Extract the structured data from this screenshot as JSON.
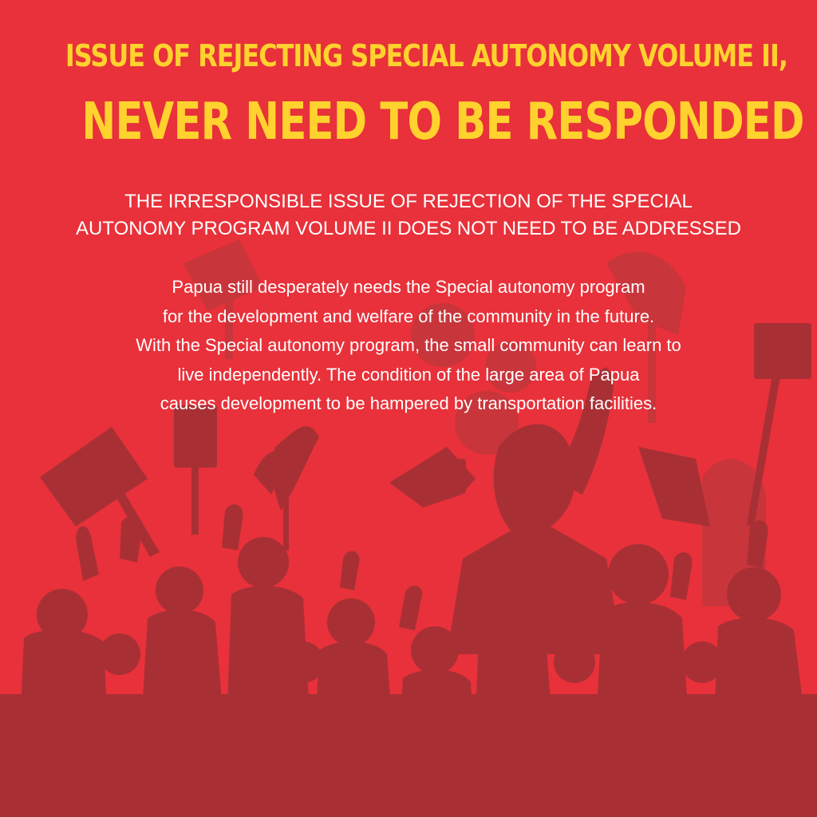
{
  "headline": {
    "line1": "ISSUE OF REJECTING SPECIAL AUTONOMY VOLUME II,",
    "line2": "NEVER NEED TO BE RESPONDED TO"
  },
  "subheading": {
    "lines": [
      "THE IRRESPONSIBLE ISSUE OF REJECTION OF THE SPECIAL",
      "AUTONOMY PROGRAM VOLUME II DOES NOT NEED TO BE ADDRESSED"
    ]
  },
  "body": {
    "lines": [
      "Papua still desperately needs the Special autonomy program",
      "for the development and welfare of the community in the future.",
      "With the Special autonomy program, the small community can learn to",
      "live independently. The condition of the large area of Papua",
      "causes development to be hampered by transportation facilities."
    ]
  },
  "colors": {
    "background": "#E8313A",
    "headline": "#FFD22E",
    "text": "#FFFFFF",
    "silhouette": "#A83035",
    "silhouette_faint": "#C8353B"
  },
  "illustration": {
    "icon": "protest-crowd-silhouette-icon"
  }
}
